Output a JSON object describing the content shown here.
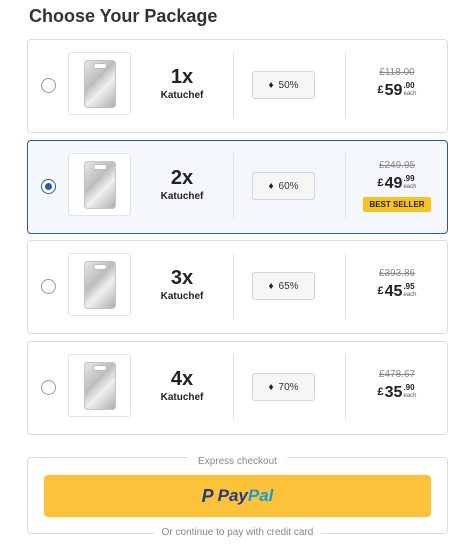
{
  "title": "Choose Your Package",
  "packages": [
    {
      "qty": "1x",
      "name": "Katuchef",
      "discount": "50%",
      "old_price": "£118.00",
      "currency": "£",
      "price_main": "59",
      "price_cents": ".00",
      "each": "each",
      "best_seller": "",
      "selected": false
    },
    {
      "qty": "2x",
      "name": "Katuchef",
      "discount": "60%",
      "old_price": "£249.95",
      "currency": "£",
      "price_main": "49",
      "price_cents": ".99",
      "each": "each",
      "best_seller": "BEST SELLER",
      "selected": true
    },
    {
      "qty": "3x",
      "name": "Katuchef",
      "discount": "65%",
      "old_price": "£393.86",
      "currency": "£",
      "price_main": "45",
      "price_cents": ".95",
      "each": "each",
      "best_seller": "",
      "selected": false
    },
    {
      "qty": "4x",
      "name": "Katuchef",
      "discount": "70%",
      "old_price": "£478.67",
      "currency": "£",
      "price_main": "35",
      "price_cents": ".90",
      "each": "each",
      "best_seller": "",
      "selected": false
    }
  ],
  "checkout": {
    "express_label": "Express checkout",
    "paypal_pay": "Pay",
    "paypal_pal": "Pal",
    "footer_text": "Or continue to pay with credit card"
  },
  "colors": {
    "accent": "#2b5aa8",
    "paypal_yellow": "#fcc23a",
    "best_seller": "#f6c324"
  },
  "icons": {
    "tag": "tag-icon",
    "paypal": "paypal-logo-icon"
  }
}
